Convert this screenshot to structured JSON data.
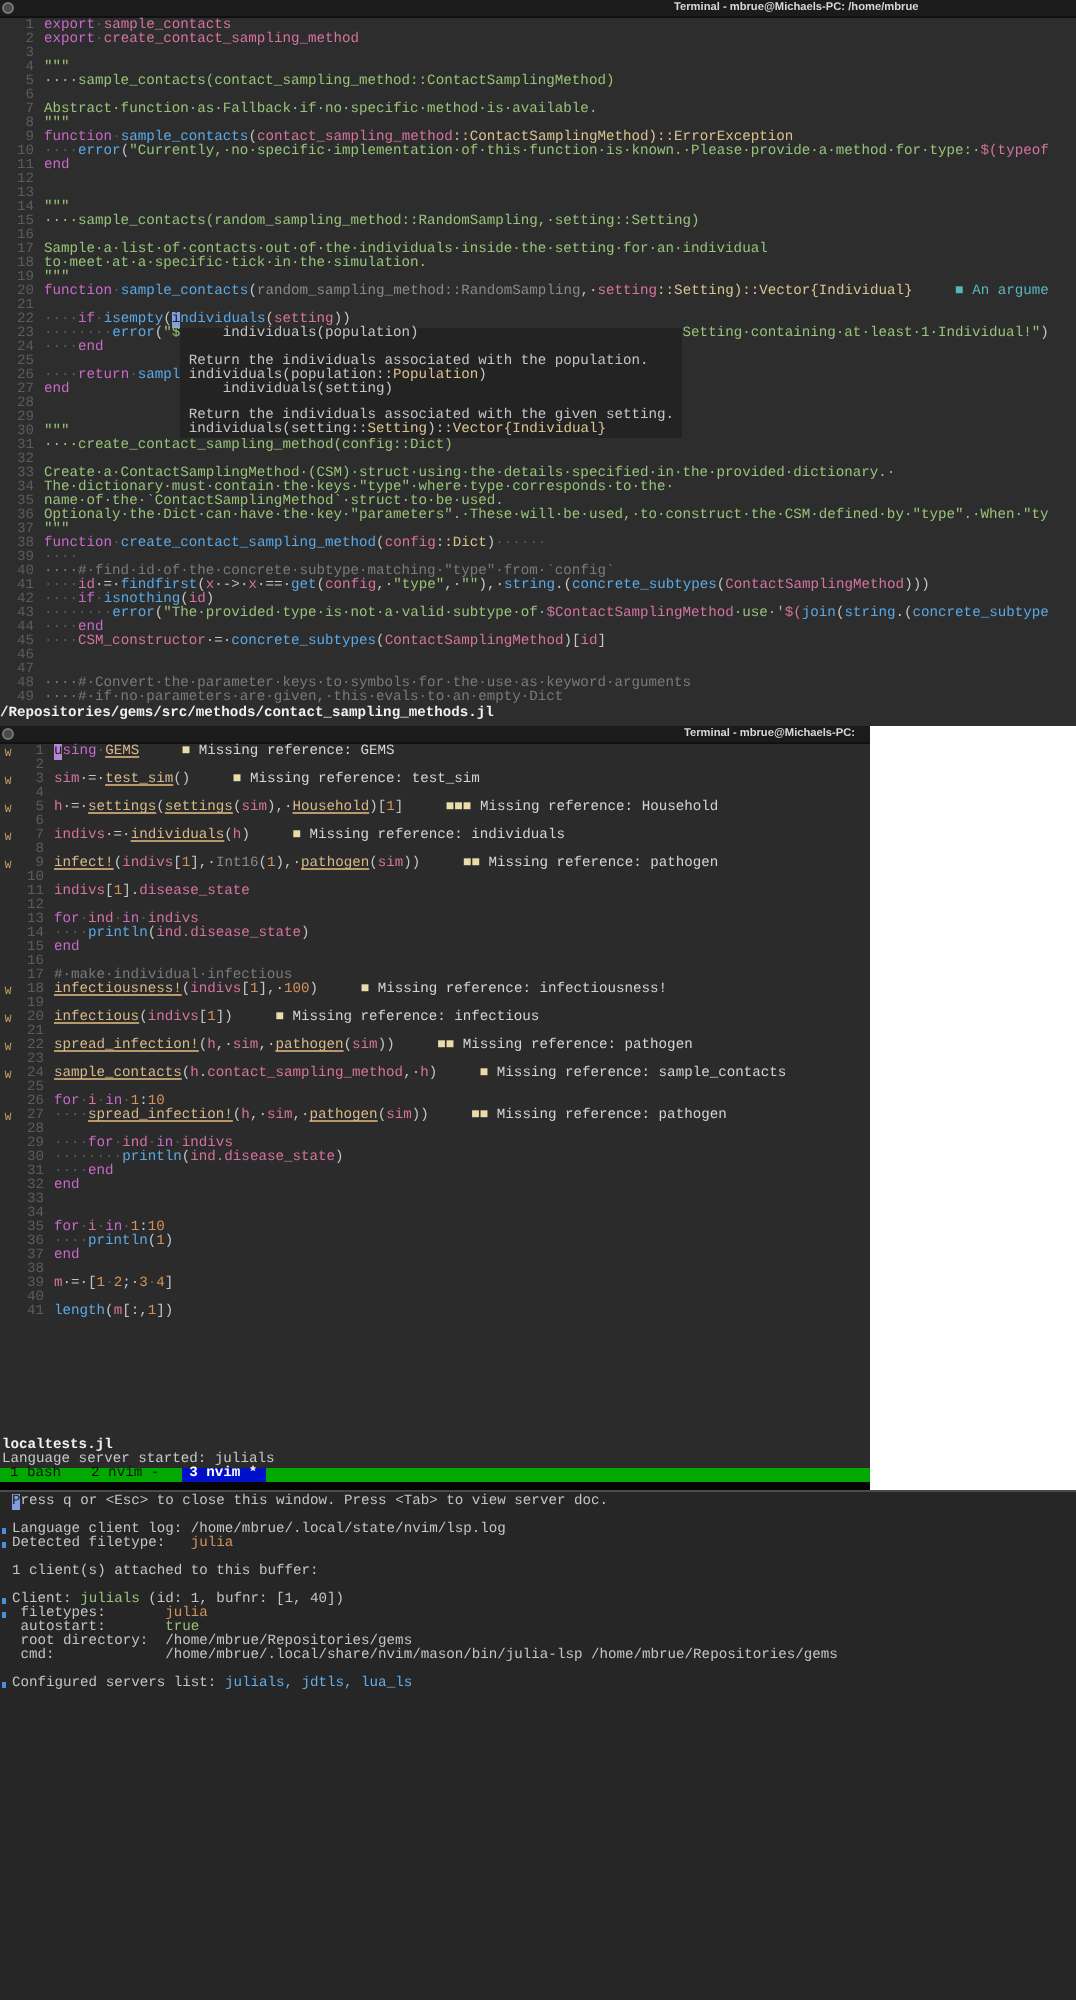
{
  "top_window": {
    "title": "Terminal - mbrue@Michaels-PC: /home/mbrue",
    "lines": [
      {
        "num": "1",
        "segs": [
          {
            "kind": "keyword",
            "text": "export"
          },
          {
            "kind": "space",
            "text": "·"
          },
          {
            "kind": "name",
            "text": "sample_contacts"
          }
        ]
      },
      {
        "num": "2",
        "segs": [
          {
            "kind": "keyword",
            "text": "export"
          },
          {
            "kind": "space",
            "text": "·"
          },
          {
            "kind": "name",
            "text": "create_contact_sampling_method"
          }
        ]
      },
      {
        "num": "3"
      },
      {
        "num": "4",
        "segs": [
          {
            "kind": "doc",
            "text": "\"\"\""
          }
        ]
      },
      {
        "num": "5",
        "segs": [
          {
            "kind": "doc",
            "text": "····sample_contacts(contact_sampling_method::ContactSamplingMethod)"
          }
        ]
      },
      {
        "num": "6"
      },
      {
        "num": "7",
        "segs": [
          {
            "kind": "doc",
            "text": "Abstract·function·as·Fallback·if·no·specific·method·is·available."
          }
        ]
      },
      {
        "num": "8",
        "segs": [
          {
            "kind": "doc",
            "text": "\"\"\""
          }
        ]
      },
      {
        "num": "9",
        "segs": [
          {
            "kind": "keyword",
            "text": "function"
          },
          {
            "kind": "space",
            "text": "·"
          },
          {
            "kind": "function",
            "text": "sample_contacts"
          },
          {
            "kind": "punct",
            "text": "("
          },
          {
            "kind": "name",
            "text": "contact_sampling_method"
          },
          {
            "kind": "type",
            "text": "::ContactSamplingMethod)::ErrorException"
          }
        ]
      },
      {
        "num": "10",
        "segs": [
          {
            "kind": "space",
            "text": "····"
          },
          {
            "kind": "function",
            "text": "error"
          },
          {
            "kind": "punct",
            "text": "("
          },
          {
            "kind": "string",
            "text": "\"Currently,·no·specific·implementation·of·this·function·is·known.·Please·provide·a·method·for·type:·"
          },
          {
            "kind": "name",
            "text": "$(typeof"
          }
        ]
      },
      {
        "num": "11",
        "segs": [
          {
            "kind": "keyword",
            "text": "end"
          }
        ]
      },
      {
        "num": "12"
      },
      {
        "num": "13"
      },
      {
        "num": "14",
        "segs": [
          {
            "kind": "doc",
            "text": "\"\"\""
          }
        ]
      },
      {
        "num": "15",
        "segs": [
          {
            "kind": "doc",
            "text": "····sample_contacts(random_sampling_method::RandomSampling,·setting::Setting)"
          }
        ]
      },
      {
        "num": "16"
      },
      {
        "num": "17",
        "segs": [
          {
            "kind": "doc",
            "text": "Sample·a·list·of·contacts·out·of·the·individuals·inside·the·setting·for·an·individual"
          }
        ]
      },
      {
        "num": "18",
        "segs": [
          {
            "kind": "doc",
            "text": "to·meet·at·a·specific·tick·in·the·simulation."
          }
        ]
      },
      {
        "num": "19",
        "segs": [
          {
            "kind": "doc",
            "text": "\"\"\""
          }
        ]
      },
      {
        "num": "20",
        "segs": [
          {
            "kind": "keyword",
            "text": "function"
          },
          {
            "kind": "space",
            "text": "·"
          },
          {
            "kind": "function",
            "text": "sample_contacts"
          },
          {
            "kind": "punct",
            "text": "("
          },
          {
            "kind": "unused",
            "text": "random_sampling_method::RandomSampling"
          },
          {
            "kind": "punct",
            "text": ",·"
          },
          {
            "kind": "name",
            "text": "setting"
          },
          {
            "kind": "type",
            "text": "::Setting)::Vector{Individual}"
          }
        ],
        "hint_mark": "■",
        "hint": "An argume"
      },
      {
        "num": "21"
      },
      {
        "num": "22",
        "segs": [
          {
            "kind": "space",
            "text": "····"
          },
          {
            "kind": "keyword",
            "text": "if"
          },
          {
            "kind": "space",
            "text": "·"
          },
          {
            "kind": "function",
            "text": "isempty"
          },
          {
            "kind": "punct",
            "text": "("
          },
          {
            "kind": "cursor",
            "text": "i"
          },
          {
            "kind": "function",
            "text": "ndividuals"
          },
          {
            "kind": "punct",
            "text": "("
          },
          {
            "kind": "name",
            "text": "setting"
          },
          {
            "kind": "punct",
            "text": "))"
          }
        ]
      },
      {
        "num": "23",
        "segs": [
          {
            "kind": "space",
            "text": "········"
          },
          {
            "kind": "function",
            "text": "error"
          },
          {
            "kind": "punct",
            "text": "("
          },
          {
            "kind": "string",
            "text": "\"$"
          }
        ],
        "after": [
          {
            "kind": "string",
            "text": "Setting·containing·at·least·1·Individual!\""
          },
          {
            "kind": "punct",
            "text": ")"
          }
        ]
      },
      {
        "num": "24",
        "segs": [
          {
            "kind": "space",
            "text": "····"
          },
          {
            "kind": "keyword",
            "text": "end"
          }
        ]
      },
      {
        "num": "25"
      },
      {
        "num": "26",
        "segs": [
          {
            "kind": "space",
            "text": "····"
          },
          {
            "kind": "keyword",
            "text": "return"
          },
          {
            "kind": "space",
            "text": "·"
          },
          {
            "kind": "function",
            "text": "sampl"
          }
        ]
      },
      {
        "num": "27",
        "segs": [
          {
            "kind": "keyword",
            "text": "end"
          }
        ]
      },
      {
        "num": "28"
      },
      {
        "num": "29"
      },
      {
        "num": "30",
        "segs": [
          {
            "kind": "doc",
            "text": "\"\"\""
          }
        ]
      },
      {
        "num": "31",
        "segs": [
          {
            "kind": "doc",
            "text": "····create_contact_sampling_method(config::Dict)"
          }
        ]
      },
      {
        "num": "32"
      },
      {
        "num": "33",
        "segs": [
          {
            "kind": "doc",
            "text": "Create·a·ContactSamplingMethod·(CSM)·struct·using·the·details·specified·in·the·provided·dictionary.·"
          }
        ]
      },
      {
        "num": "34",
        "segs": [
          {
            "kind": "doc",
            "text": "The·dictionary·must·contain·the·keys·\"type\"·where·type·corresponds·to·the·"
          }
        ]
      },
      {
        "num": "35",
        "segs": [
          {
            "kind": "doc",
            "text": "name·of·the·`ContactSamplingMethod`·struct·to·be·used."
          }
        ]
      },
      {
        "num": "36",
        "segs": [
          {
            "kind": "doc",
            "text": "Optionaly·the·Dict·can·have·the·key·\"parameters\".·These·will·be·used,·to·construct·the·CSM·defined·by·\"type\".·When·\"ty"
          }
        ]
      },
      {
        "num": "37",
        "segs": [
          {
            "kind": "doc",
            "text": "\"\"\""
          }
        ]
      },
      {
        "num": "38",
        "segs": [
          {
            "kind": "keyword",
            "text": "function"
          },
          {
            "kind": "space",
            "text": "·"
          },
          {
            "kind": "function",
            "text": "create_contact_sampling_method"
          },
          {
            "kind": "punct",
            "text": "("
          },
          {
            "kind": "name",
            "text": "config"
          },
          {
            "kind": "type",
            "text": "::Dict"
          },
          {
            "kind": "punct",
            "text": ")"
          },
          {
            "kind": "space",
            "text": "······"
          }
        ]
      },
      {
        "num": "39",
        "segs": [
          {
            "kind": "space",
            "text": "····"
          }
        ]
      },
      {
        "num": "40",
        "segs": [
          {
            "kind": "comment",
            "text": "····#·find·id·of·the·concrete·subtype·matching·\"type\"·from·`config`"
          }
        ]
      },
      {
        "num": "41",
        "segs": [
          {
            "kind": "space",
            "text": "····"
          },
          {
            "kind": "name",
            "text": "id"
          },
          {
            "kind": "punct",
            "text": "·=·"
          },
          {
            "kind": "function",
            "text": "findfirst"
          },
          {
            "kind": "punct",
            "text": "("
          },
          {
            "kind": "name",
            "text": "x"
          },
          {
            "kind": "punct",
            "text": "·->·"
          },
          {
            "kind": "name",
            "text": "x"
          },
          {
            "kind": "punct",
            "text": "·==·"
          },
          {
            "kind": "function",
            "text": "get"
          },
          {
            "kind": "punct",
            "text": "("
          },
          {
            "kind": "name",
            "text": "config"
          },
          {
            "kind": "punct",
            "text": ",·"
          },
          {
            "kind": "string",
            "text": "\"type\""
          },
          {
            "kind": "punct",
            "text": ",·"
          },
          {
            "kind": "string",
            "text": "\"\""
          },
          {
            "kind": "punct",
            "text": "),·"
          },
          {
            "kind": "function",
            "text": "string"
          },
          {
            "kind": "punct",
            "text": ".("
          },
          {
            "kind": "function",
            "text": "concrete_subtypes"
          },
          {
            "kind": "punct",
            "text": "("
          },
          {
            "kind": "name",
            "text": "ContactSamplingMethod"
          },
          {
            "kind": "punct",
            "text": ")))"
          }
        ]
      },
      {
        "num": "42",
        "segs": [
          {
            "kind": "space",
            "text": "····"
          },
          {
            "kind": "keyword",
            "text": "if"
          },
          {
            "kind": "space",
            "text": "·"
          },
          {
            "kind": "function",
            "text": "isnothing"
          },
          {
            "kind": "punct",
            "text": "("
          },
          {
            "kind": "name",
            "text": "id"
          },
          {
            "kind": "punct",
            "text": ")"
          }
        ]
      },
      {
        "num": "43",
        "segs": [
          {
            "kind": "space",
            "text": "········"
          },
          {
            "kind": "function",
            "text": "error"
          },
          {
            "kind": "punct",
            "text": "("
          },
          {
            "kind": "string",
            "text": "\"The·provided·type·is·not·a·valid·subtype·of·"
          },
          {
            "kind": "name",
            "text": "$ContactSamplingMethod"
          },
          {
            "kind": "string",
            "text": "·use·'"
          },
          {
            "kind": "name",
            "text": "$("
          },
          {
            "kind": "function",
            "text": "join"
          },
          {
            "kind": "punct",
            "text": "("
          },
          {
            "kind": "function",
            "text": "string"
          },
          {
            "kind": "punct",
            "text": ".("
          },
          {
            "kind": "function",
            "text": "concrete_subtype"
          }
        ]
      },
      {
        "num": "44",
        "segs": [
          {
            "kind": "space",
            "text": "····"
          },
          {
            "kind": "keyword",
            "text": "end"
          }
        ]
      },
      {
        "num": "45",
        "segs": [
          {
            "kind": "space",
            "text": "····"
          },
          {
            "kind": "name",
            "text": "CSM_constructor"
          },
          {
            "kind": "punct",
            "text": "·=·"
          },
          {
            "kind": "function",
            "text": "concrete_subtypes"
          },
          {
            "kind": "punct",
            "text": "("
          },
          {
            "kind": "name",
            "text": "ContactSamplingMethod"
          },
          {
            "kind": "punct",
            "text": ")["
          },
          {
            "kind": "name",
            "text": "id"
          },
          {
            "kind": "punct",
            "text": "]"
          }
        ]
      },
      {
        "num": "46"
      },
      {
        "num": "47"
      },
      {
        "num": "48",
        "segs": [
          {
            "kind": "comment",
            "text": "····#·Convert·the·parameter·keys·to·symbols·for·the·use·as·keyword·arguments"
          }
        ]
      },
      {
        "num": "49",
        "segs": [
          {
            "kind": "comment",
            "text": "····#·if·no·parameters·are·given,·this·evals·to·an·empty·Dict"
          }
        ]
      }
    ],
    "popup": [
      {
        "lines": [
          {
            "segs": [
              {
                "kind": "punct",
                "text": "    individuals(population)"
              }
            ]
          }
        ]
      },
      {
        "lines": [
          {
            "segs": [
              {
                "kind": "punct",
                "text": "Return the individuals associated with the population."
              }
            ]
          },
          {
            "segs": [
              {
                "kind": "punct",
                "text": "individuals(population::"
              },
              {
                "kind": "type",
                "text": "Population"
              },
              {
                "kind": "punct",
                "text": ")"
              }
            ]
          },
          {
            "segs": [
              {
                "kind": "punct",
                "text": "    individuals(setting)"
              }
            ]
          }
        ]
      },
      {
        "lines": [
          {
            "segs": [
              {
                "kind": "punct",
                "text": "Return the individuals associated with the given setting."
              }
            ]
          },
          {
            "segs": [
              {
                "kind": "punct",
                "text": "individuals(setting::"
              },
              {
                "kind": "type",
                "text": "Setting"
              },
              {
                "kind": "punct",
                "text": ")::"
              },
              {
                "kind": "type",
                "text": "Vector{Individual}"
              }
            ]
          }
        ]
      }
    ],
    "file_path": "/Repositories/gems/src/methods/contact_sampling_methods.jl"
  },
  "second_window": {
    "title": "Terminal - mbrue@Michaels-PC:",
    "lines": [
      {
        "num": "1",
        "sign": "W",
        "segs": [
          {
            "kind": "cursor2",
            "text": "u"
          },
          {
            "kind": "keyword",
            "text": "sing"
          },
          {
            "kind": "space",
            "text": "·"
          },
          {
            "kind": "ref",
            "text": "GEMS"
          }
        ],
        "marks": "■",
        "message": "Missing reference: GEMS"
      },
      {
        "num": "2"
      },
      {
        "num": "3",
        "sign": "W",
        "segs": [
          {
            "kind": "name",
            "text": "sim"
          },
          {
            "kind": "punct",
            "text": "·=·"
          },
          {
            "kind": "ref",
            "text": "test_sim"
          },
          {
            "kind": "punct",
            "text": "()"
          }
        ],
        "marks": "■",
        "message": "Missing reference: test_sim"
      },
      {
        "num": "4"
      },
      {
        "num": "5",
        "sign": "W",
        "segs": [
          {
            "kind": "name",
            "text": "h"
          },
          {
            "kind": "punct",
            "text": "·=·"
          },
          {
            "kind": "ref",
            "text": "settings"
          },
          {
            "kind": "punct",
            "text": "("
          },
          {
            "kind": "ref",
            "text": "settings"
          },
          {
            "kind": "punct",
            "text": "("
          },
          {
            "kind": "name",
            "text": "sim"
          },
          {
            "kind": "punct",
            "text": "),·"
          },
          {
            "kind": "ref",
            "text": "Household"
          },
          {
            "kind": "punct",
            "text": ")["
          },
          {
            "kind": "number",
            "text": "1"
          },
          {
            "kind": "punct",
            "text": "]"
          }
        ],
        "marks": "■■■",
        "message": "Missing reference: Household"
      },
      {
        "num": "6"
      },
      {
        "num": "7",
        "sign": "W",
        "segs": [
          {
            "kind": "name",
            "text": "indivs"
          },
          {
            "kind": "punct",
            "text": "·=·"
          },
          {
            "kind": "ref",
            "text": "individuals"
          },
          {
            "kind": "punct",
            "text": "("
          },
          {
            "kind": "name",
            "text": "h"
          },
          {
            "kind": "punct",
            "text": ")"
          }
        ],
        "marks": "■",
        "message": "Missing reference: individuals"
      },
      {
        "num": "8"
      },
      {
        "num": "9",
        "sign": "W",
        "segs": [
          {
            "kind": "ref",
            "text": "infect!"
          },
          {
            "kind": "punct",
            "text": "("
          },
          {
            "kind": "name",
            "text": "indivs"
          },
          {
            "kind": "punct",
            "text": "["
          },
          {
            "kind": "number",
            "text": "1"
          },
          {
            "kind": "punct",
            "text": "],·"
          },
          {
            "kind": "unused",
            "text": "Int16"
          },
          {
            "kind": "punct",
            "text": "("
          },
          {
            "kind": "number",
            "text": "1"
          },
          {
            "kind": "punct",
            "text": "),·"
          },
          {
            "kind": "ref",
            "text": "pathogen"
          },
          {
            "kind": "punct",
            "text": "("
          },
          {
            "kind": "name",
            "text": "sim"
          },
          {
            "kind": "punct",
            "text": "))"
          }
        ],
        "marks": "■■",
        "message": "Missing reference: pathogen"
      },
      {
        "num": "10"
      },
      {
        "num": "11",
        "segs": [
          {
            "kind": "name",
            "text": "indivs"
          },
          {
            "kind": "punct",
            "text": "["
          },
          {
            "kind": "number",
            "text": "1"
          },
          {
            "kind": "punct",
            "text": "]."
          },
          {
            "kind": "name",
            "text": "disease_state"
          }
        ]
      },
      {
        "num": "12"
      },
      {
        "num": "13",
        "segs": [
          {
            "kind": "keyword",
            "text": "for"
          },
          {
            "kind": "space",
            "text": "·"
          },
          {
            "kind": "name",
            "text": "ind"
          },
          {
            "kind": "space",
            "text": "·"
          },
          {
            "kind": "keyword",
            "text": "in"
          },
          {
            "kind": "space",
            "text": "·"
          },
          {
            "kind": "name",
            "text": "indivs"
          }
        ]
      },
      {
        "num": "14",
        "segs": [
          {
            "kind": "space",
            "text": "····"
          },
          {
            "kind": "function",
            "text": "println"
          },
          {
            "kind": "punct",
            "text": "("
          },
          {
            "kind": "name",
            "text": "ind.disease_state"
          },
          {
            "kind": "punct",
            "text": ")"
          }
        ]
      },
      {
        "num": "15",
        "segs": [
          {
            "kind": "keyword",
            "text": "end"
          }
        ]
      },
      {
        "num": "16"
      },
      {
        "num": "17",
        "segs": [
          {
            "kind": "comment",
            "text": "#·make·individual·infectious"
          }
        ]
      },
      {
        "num": "18",
        "sign": "W",
        "segs": [
          {
            "kind": "ref",
            "text": "infectiousness!"
          },
          {
            "kind": "punct",
            "text": "("
          },
          {
            "kind": "name",
            "text": "indivs"
          },
          {
            "kind": "punct",
            "text": "["
          },
          {
            "kind": "number",
            "text": "1"
          },
          {
            "kind": "punct",
            "text": "],·"
          },
          {
            "kind": "number",
            "text": "100"
          },
          {
            "kind": "punct",
            "text": ")"
          }
        ],
        "marks": "■",
        "message": "Missing reference: infectiousness!"
      },
      {
        "num": "19"
      },
      {
        "num": "20",
        "sign": "W",
        "segs": [
          {
            "kind": "ref",
            "text": "infectious"
          },
          {
            "kind": "punct",
            "text": "("
          },
          {
            "kind": "name",
            "text": "indivs"
          },
          {
            "kind": "punct",
            "text": "["
          },
          {
            "kind": "number",
            "text": "1"
          },
          {
            "kind": "punct",
            "text": "])"
          }
        ],
        "marks": "■",
        "message": "Missing reference: infectious"
      },
      {
        "num": "21"
      },
      {
        "num": "22",
        "sign": "W",
        "segs": [
          {
            "kind": "ref",
            "text": "spread_infection!"
          },
          {
            "kind": "punct",
            "text": "("
          },
          {
            "kind": "name",
            "text": "h"
          },
          {
            "kind": "punct",
            "text": ",·"
          },
          {
            "kind": "name",
            "text": "sim"
          },
          {
            "kind": "punct",
            "text": ",·"
          },
          {
            "kind": "ref",
            "text": "pathogen"
          },
          {
            "kind": "punct",
            "text": "("
          },
          {
            "kind": "name",
            "text": "sim"
          },
          {
            "kind": "punct",
            "text": "))"
          }
        ],
        "marks": "■■",
        "message": "Missing reference: pathogen"
      },
      {
        "num": "23"
      },
      {
        "num": "24",
        "sign": "W",
        "segs": [
          {
            "kind": "ref",
            "text": "sample_contacts"
          },
          {
            "kind": "punct",
            "text": "("
          },
          {
            "kind": "name",
            "text": "h"
          },
          {
            "kind": "punct",
            "text": "."
          },
          {
            "kind": "name",
            "text": "contact_sampling_method"
          },
          {
            "kind": "punct",
            "text": ",·"
          },
          {
            "kind": "name",
            "text": "h"
          },
          {
            "kind": "punct",
            "text": ")"
          }
        ],
        "marks": "■",
        "message": "Missing reference: sample_contacts"
      },
      {
        "num": "25"
      },
      {
        "num": "26",
        "segs": [
          {
            "kind": "keyword",
            "text": "for"
          },
          {
            "kind": "space",
            "text": "·"
          },
          {
            "kind": "name",
            "text": "i"
          },
          {
            "kind": "space",
            "text": "·"
          },
          {
            "kind": "keyword",
            "text": "in"
          },
          {
            "kind": "space",
            "text": "·"
          },
          {
            "kind": "number",
            "text": "1"
          },
          {
            "kind": "punct",
            "text": ":"
          },
          {
            "kind": "number",
            "text": "10"
          }
        ]
      },
      {
        "num": "27",
        "sign": "W",
        "segs": [
          {
            "kind": "space",
            "text": "····"
          },
          {
            "kind": "ref",
            "text": "spread_infection!"
          },
          {
            "kind": "punct",
            "text": "("
          },
          {
            "kind": "name",
            "text": "h"
          },
          {
            "kind": "punct",
            "text": ",·"
          },
          {
            "kind": "name",
            "text": "sim"
          },
          {
            "kind": "punct",
            "text": ",·"
          },
          {
            "kind": "ref",
            "text": "pathogen"
          },
          {
            "kind": "punct",
            "text": "("
          },
          {
            "kind": "name",
            "text": "sim"
          },
          {
            "kind": "punct",
            "text": "))"
          }
        ],
        "marks": "■■",
        "message": "Missing reference: pathogen"
      },
      {
        "num": "28"
      },
      {
        "num": "29",
        "segs": [
          {
            "kind": "space",
            "text": "····"
          },
          {
            "kind": "keyword",
            "text": "for"
          },
          {
            "kind": "space",
            "text": "·"
          },
          {
            "kind": "name",
            "text": "ind"
          },
          {
            "kind": "space",
            "text": "·"
          },
          {
            "kind": "keyword",
            "text": "in"
          },
          {
            "kind": "space",
            "text": "·"
          },
          {
            "kind": "name",
            "text": "indivs"
          }
        ]
      },
      {
        "num": "30",
        "segs": [
          {
            "kind": "space",
            "text": "········"
          },
          {
            "kind": "function",
            "text": "println"
          },
          {
            "kind": "punct",
            "text": "("
          },
          {
            "kind": "name",
            "text": "ind.disease_state"
          },
          {
            "kind": "punct",
            "text": ")"
          }
        ]
      },
      {
        "num": "31",
        "segs": [
          {
            "kind": "space",
            "text": "····"
          },
          {
            "kind": "keyword",
            "text": "end"
          }
        ]
      },
      {
        "num": "32",
        "segs": [
          {
            "kind": "keyword",
            "text": "end"
          }
        ]
      },
      {
        "num": "33"
      },
      {
        "num": "34"
      },
      {
        "num": "35",
        "segs": [
          {
            "kind": "keyword",
            "text": "for"
          },
          {
            "kind": "space",
            "text": "·"
          },
          {
            "kind": "name",
            "text": "i"
          },
          {
            "kind": "space",
            "text": "·"
          },
          {
            "kind": "keyword",
            "text": "in"
          },
          {
            "kind": "space",
            "text": "·"
          },
          {
            "kind": "number",
            "text": "1"
          },
          {
            "kind": "punct",
            "text": ":"
          },
          {
            "kind": "number",
            "text": "10"
          }
        ]
      },
      {
        "num": "36",
        "segs": [
          {
            "kind": "space",
            "text": "····"
          },
          {
            "kind": "function",
            "text": "println"
          },
          {
            "kind": "punct",
            "text": "("
          },
          {
            "kind": "number",
            "text": "1"
          },
          {
            "kind": "punct",
            "text": ")"
          }
        ]
      },
      {
        "num": "37",
        "segs": [
          {
            "kind": "keyword",
            "text": "end"
          }
        ]
      },
      {
        "num": "38"
      },
      {
        "num": "39",
        "segs": [
          {
            "kind": "name",
            "text": "m"
          },
          {
            "kind": "punct",
            "text": "·=·["
          },
          {
            "kind": "number",
            "text": "1"
          },
          {
            "kind": "space",
            "text": "·"
          },
          {
            "kind": "number",
            "text": "2"
          },
          {
            "kind": "punct",
            "text": ";·"
          },
          {
            "kind": "number",
            "text": "3"
          },
          {
            "kind": "space",
            "text": "·"
          },
          {
            "kind": "number",
            "text": "4"
          },
          {
            "kind": "punct",
            "text": "]"
          }
        ]
      },
      {
        "num": "40"
      },
      {
        "num": "41",
        "segs": [
          {
            "kind": "function",
            "text": "length"
          },
          {
            "kind": "punct",
            "text": "("
          },
          {
            "kind": "name",
            "text": "m"
          },
          {
            "kind": "punct",
            "text": "[:,"
          },
          {
            "kind": "number",
            "text": "1"
          },
          {
            "kind": "punct",
            "text": "])"
          }
        ]
      }
    ],
    "file_name": "localtests.jl",
    "message": "Language server started: julials",
    "tabs": [
      {
        "label": "1 bash",
        "selected": false
      },
      {
        "label": "2 nvim -",
        "selected": false
      },
      {
        "label": "3 nvim *",
        "selected": true
      }
    ]
  },
  "lsp_info": {
    "lines": [
      {
        "segs": [
          {
            "kind": "cursor",
            "text": "P"
          },
          {
            "kind": "punct",
            "text": "ress q or <Esc> to close this window. Press <Tab> to view server doc."
          }
        ],
        "marked": false
      },
      {
        "marked": false
      },
      {
        "segs": [
          {
            "kind": "punct",
            "text": "Language client log: /home/mbrue/.local/state/nvim/lsp.log"
          }
        ],
        "marked": true
      },
      {
        "segs": [
          {
            "kind": "punct",
            "text": "Detected filetype:   "
          },
          {
            "kind": "number",
            "text": "julia"
          }
        ],
        "marked": true
      },
      {
        "marked": false
      },
      {
        "segs": [
          {
            "kind": "punct",
            "text": "1 client(s) attached to this buffer:"
          }
        ],
        "marked": false
      },
      {
        "marked": false
      },
      {
        "segs": [
          {
            "kind": "punct",
            "text": "Client: "
          },
          {
            "kind": "ok",
            "text": "julials"
          },
          {
            "kind": "punct",
            "text": " (id: 1, bufnr: [1, 40])"
          }
        ],
        "marked": true
      },
      {
        "segs": [
          {
            "kind": "punct",
            "text": " filetypes:       "
          },
          {
            "kind": "number",
            "text": "julia"
          }
        ],
        "marked": true
      },
      {
        "segs": [
          {
            "kind": "punct",
            "text": " autostart:       "
          },
          {
            "kind": "ok",
            "text": "true"
          }
        ],
        "marked": false
      },
      {
        "segs": [
          {
            "kind": "punct",
            "text": " root directory:  /home/mbrue/Repositories/gems"
          }
        ],
        "marked": false
      },
      {
        "segs": [
          {
            "kind": "punct",
            "text": " cmd:             /home/mbrue/.local/share/nvim/mason/bin/julia-lsp /home/mbrue/Repositories/gems"
          }
        ],
        "marked": false
      },
      {
        "marked": false
      },
      {
        "segs": [
          {
            "kind": "punct",
            "text": "Configured servers list: "
          },
          {
            "kind": "list",
            "text": "julials, jdtls, lua_ls"
          }
        ],
        "marked": true
      }
    ]
  }
}
